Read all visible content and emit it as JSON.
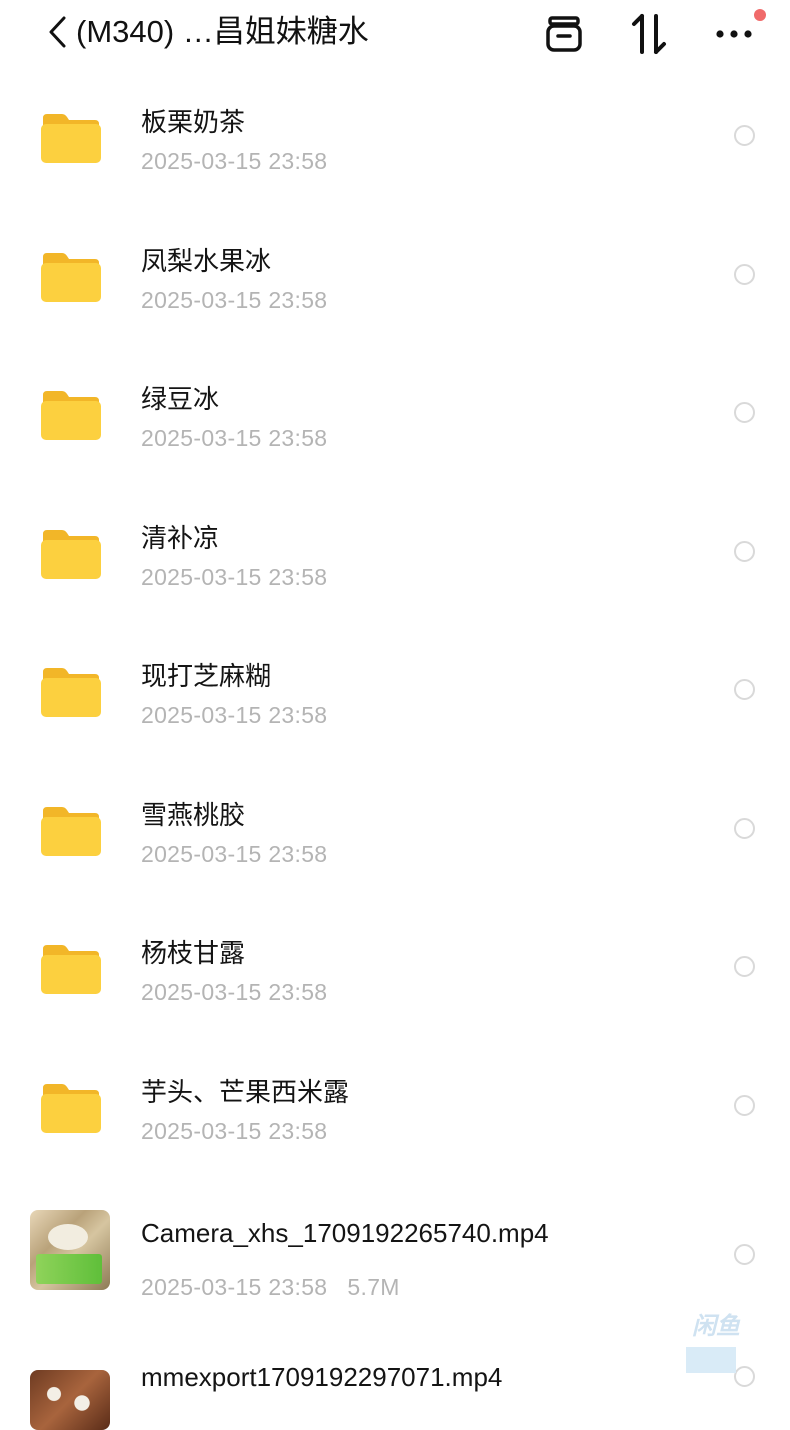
{
  "header": {
    "title": "(M340) …昌姐妹糖水",
    "back_icon": "chevron-left-icon",
    "icons": [
      "save-box-icon",
      "sort-icon",
      "more-icon"
    ],
    "notification_color": "#f06a6a"
  },
  "folders": [
    {
      "name": "板栗奶茶",
      "date": "2025-03-15 23:58"
    },
    {
      "name": "凤梨水果冰",
      "date": "2025-03-15 23:58"
    },
    {
      "name": "绿豆冰",
      "date": "2025-03-15 23:58"
    },
    {
      "name": "清补凉",
      "date": "2025-03-15 23:58"
    },
    {
      "name": "现打芝麻糊",
      "date": "2025-03-15 23:58"
    },
    {
      "name": "雪燕桃胶",
      "date": "2025-03-15 23:58"
    },
    {
      "name": "杨枝甘露",
      "date": "2025-03-15 23:58"
    },
    {
      "name": "芋头、芒果西米露",
      "date": "2025-03-15 23:58"
    }
  ],
  "files": [
    {
      "name": "Camera_xhs_1709192265740.mp4",
      "date": "2025-03-15 23:58",
      "size": "5.7M"
    },
    {
      "name": "mmexport1709192297071.mp4",
      "date": "",
      "size": ""
    }
  ],
  "colors": {
    "folder": "#fcd03f",
    "meta": "#b4b4b4",
    "text": "#141414"
  }
}
